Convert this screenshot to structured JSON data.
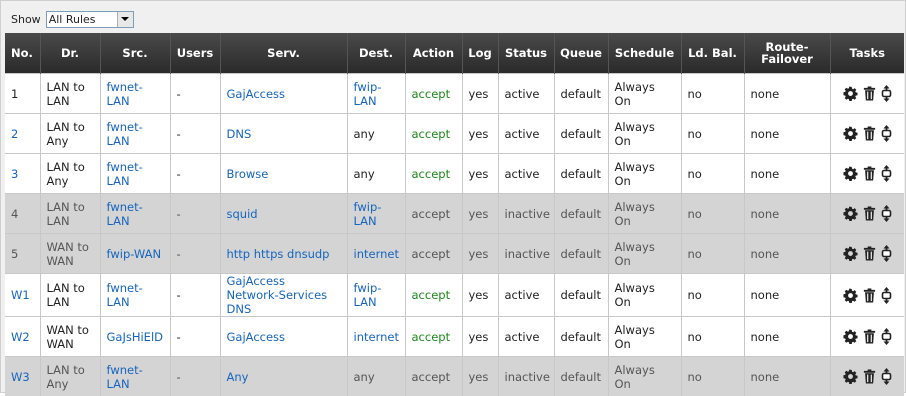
{
  "filter": {
    "show_label": "Show",
    "selected": "All Rules"
  },
  "columns": [
    "No.",
    "Dr.",
    "Src.",
    "Users",
    "Serv.",
    "Dest.",
    "Action",
    "Log",
    "Status",
    "Queue",
    "Schedule",
    "Ld. Bal.",
    "Route-Failover",
    "Tasks"
  ],
  "rows": [
    {
      "no": "1",
      "dr": "LAN to LAN",
      "src": "fwnet-LAN",
      "users": "-",
      "serv": "GajAccess",
      "dest": "fwip-LAN",
      "action": "accept",
      "log": "yes",
      "status": "active",
      "queue": "default",
      "schedule": "Always On",
      "ldbal": "no",
      "failover": "none",
      "disabled": false,
      "no_link": false,
      "dest_link": true
    },
    {
      "no": "2",
      "dr": "LAN to Any",
      "src": "fwnet-LAN",
      "users": "-",
      "serv": "DNS",
      "dest": "any",
      "action": "accept",
      "log": "yes",
      "status": "active",
      "queue": "default",
      "schedule": "Always On",
      "ldbal": "no",
      "failover": "none",
      "disabled": false,
      "no_link": true,
      "dest_link": false
    },
    {
      "no": "3",
      "dr": "LAN to Any",
      "src": "fwnet-LAN",
      "users": "-",
      "serv": "Browse",
      "dest": "any",
      "action": "accept",
      "log": "yes",
      "status": "active",
      "queue": "default",
      "schedule": "Always On",
      "ldbal": "no",
      "failover": "none",
      "disabled": false,
      "no_link": true,
      "dest_link": false
    },
    {
      "no": "4",
      "dr": "LAN to LAN",
      "src": "fwnet-LAN",
      "users": "-",
      "serv": "squid",
      "dest": "fwip-LAN",
      "action": "accept",
      "log": "yes",
      "status": "inactive",
      "queue": "default",
      "schedule": "Always On",
      "ldbal": "no",
      "failover": "none",
      "disabled": true,
      "no_link": false,
      "dest_link": true
    },
    {
      "no": "5",
      "dr": "WAN to WAN",
      "src": "fwip-WAN",
      "users": "-",
      "serv": "http https dnsudp",
      "dest": "internet",
      "action": "accept",
      "log": "yes",
      "status": "inactive",
      "queue": "default",
      "schedule": "Always On",
      "ldbal": "no",
      "failover": "none",
      "disabled": true,
      "no_link": false,
      "dest_link": true
    },
    {
      "no": "W1",
      "dr": "LAN to LAN",
      "src": "fwnet-LAN",
      "users": "-",
      "serv": "GajAccess Network-Services DNS",
      "dest": "fwip-LAN",
      "action": "accept",
      "log": "yes",
      "status": "active",
      "queue": "default",
      "schedule": "Always On",
      "ldbal": "no",
      "failover": "none",
      "disabled": false,
      "no_link": true,
      "dest_link": true
    },
    {
      "no": "W2",
      "dr": "WAN to WAN",
      "src": "GaJsHiElD",
      "users": "-",
      "serv": "GajAccess",
      "dest": "internet",
      "action": "accept",
      "log": "yes",
      "status": "active",
      "queue": "default",
      "schedule": "Always On",
      "ldbal": "no",
      "failover": "none",
      "disabled": false,
      "no_link": true,
      "dest_link": true
    },
    {
      "no": "W3",
      "dr": "LAN to Any",
      "src": "fwnet-LAN",
      "users": "-",
      "serv": "Any",
      "dest": "any",
      "action": "accept",
      "log": "yes",
      "status": "inactive",
      "queue": "default",
      "schedule": "Always On",
      "ldbal": "no",
      "failover": "none",
      "disabled": true,
      "no_link": true,
      "dest_link": false
    }
  ],
  "task_icons": [
    "gear-icon",
    "trash-icon",
    "move-icon"
  ],
  "colors": {
    "header_bg": "#333333",
    "link": "#1565c0",
    "accept": "#1a8a1a",
    "disabled_row": "#d4d4d4"
  }
}
